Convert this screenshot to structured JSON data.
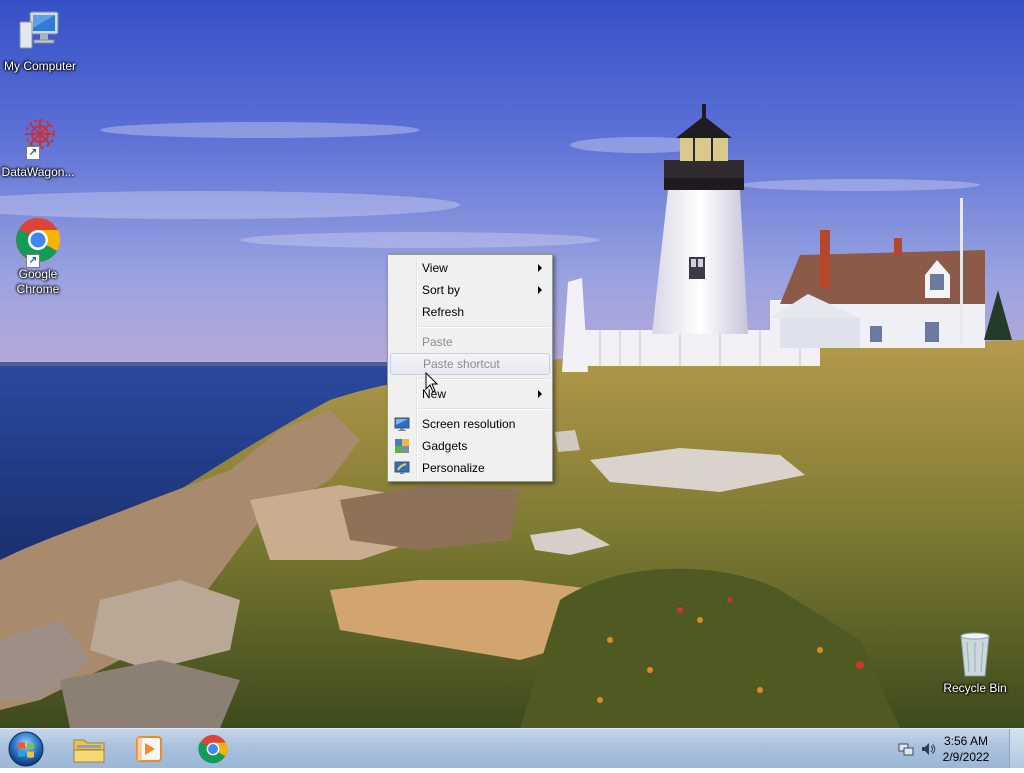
{
  "desktop": {
    "icons": [
      {
        "label": "My Computer",
        "icon": "computer-icon"
      },
      {
        "label": "DataWagon...",
        "icon": "datawagon-icon"
      },
      {
        "label": "Google Chrome",
        "icon": "chrome-icon"
      },
      {
        "label": "Recycle Bin",
        "icon": "recycle-bin-icon"
      }
    ]
  },
  "context_menu": {
    "items": [
      {
        "label": "View",
        "submenu": true,
        "disabled": false
      },
      {
        "label": "Sort by",
        "submenu": true,
        "disabled": false
      },
      {
        "label": "Refresh",
        "submenu": false,
        "disabled": false
      },
      {
        "label": "Paste",
        "submenu": false,
        "disabled": true
      },
      {
        "label": "Paste shortcut",
        "submenu": false,
        "disabled": true,
        "highlighted": true
      },
      {
        "label": "New",
        "submenu": true,
        "disabled": false
      },
      {
        "label": "Screen resolution",
        "submenu": false,
        "disabled": false,
        "icon": "screen-resolution-icon"
      },
      {
        "label": "Gadgets",
        "submenu": false,
        "disabled": false,
        "icon": "gadgets-icon"
      },
      {
        "label": "Personalize",
        "submenu": false,
        "disabled": false,
        "icon": "personalize-icon"
      }
    ]
  },
  "taskbar": {
    "start_icon": "windows-orb-icon",
    "pinned": [
      "file-explorer-icon",
      "media-player-icon",
      "chrome-icon"
    ],
    "tray_icons": [
      "network-icon",
      "volume-icon"
    ],
    "clock": {
      "time": "3:56 AM",
      "date": "2/9/2022"
    }
  },
  "colors": {
    "menu_bg": "#f0f0f0",
    "taskbar": "#a9c1dd",
    "sky_top": "#3a55c8",
    "sea": "#1d3f8a"
  }
}
